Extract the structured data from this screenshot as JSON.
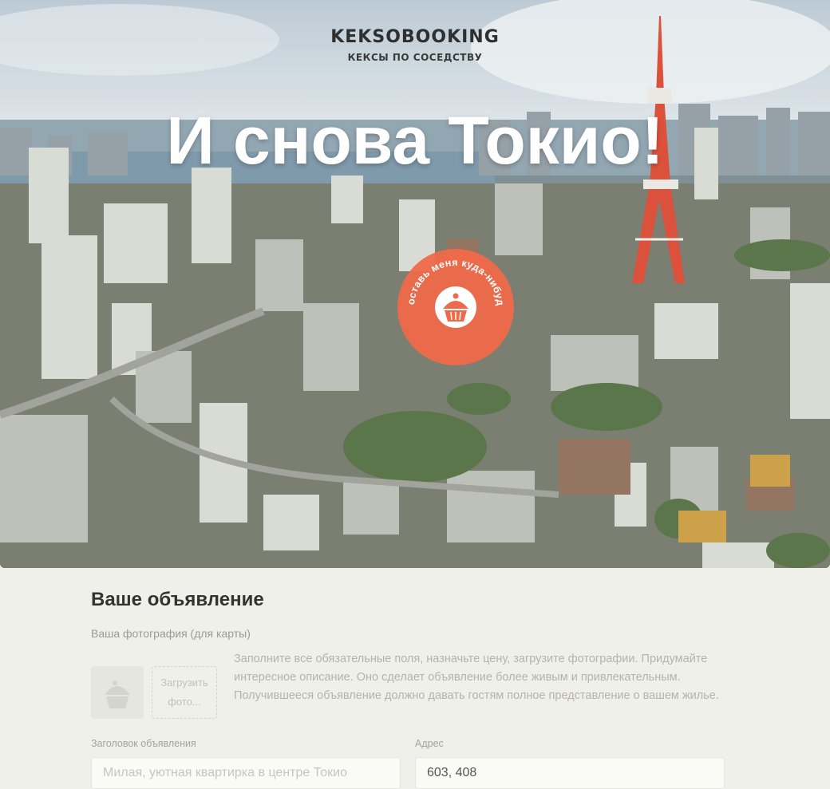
{
  "header": {
    "logo": "KEKSOBOOKING",
    "tagline": "КЕКСЫ ПО СОСЕДСТВУ"
  },
  "hero": {
    "title": "И снова Токио!",
    "pin_text": "Поставь меня куда-нибудь"
  },
  "form": {
    "title": "Ваше объявление",
    "photo_label": "Ваша фотография (для карты)",
    "upload_label": "Загрузить фото...",
    "hint": "Заполните все обязательные поля, назначьте цену, загрузите фотографии. Придумайте интересное описание. Оно сделает объявление более живым и привлекательным. Получившееся объявление должно давать гостям полное представление о вашем жилье.",
    "title_field": {
      "label": "Заголовок объявления",
      "placeholder": "Милая, уютная квартирка в центре Токио"
    },
    "address_field": {
      "label": "Адрес",
      "value": "603, 408"
    }
  },
  "colors": {
    "pin": "#ef6a4a",
    "tower": "#d9432c",
    "background": "#f0f0ea"
  },
  "icons": {
    "pin": "muffin-icon",
    "avatar": "muffin-icon"
  }
}
